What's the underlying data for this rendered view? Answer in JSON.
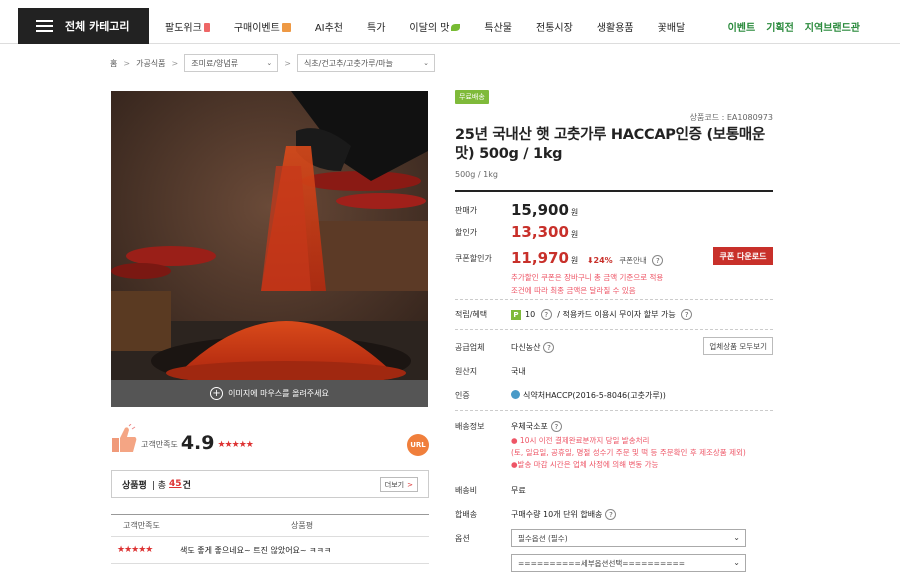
{
  "nav": {
    "all_category": "전체 카테고리",
    "items": [
      "팔도위크",
      "구매이벤트",
      "AI추천",
      "특가",
      "이달의 맛",
      "특산물",
      "전통시장",
      "생활용품",
      "꽃배달"
    ],
    "right_items": [
      "이벤트",
      "기획전",
      "지역브랜드관"
    ]
  },
  "breadcrumb": {
    "home": "홈",
    "level1": "가공식품",
    "level2": "조미료/양념류",
    "level3": "식초/건고추/고춧가루/마늘"
  },
  "image_bar": "이미지에 마우스를 올려주세요",
  "rating": {
    "label": "고객만족도",
    "score": "4.9",
    "stars": "★★★★★",
    "url_label": "URL"
  },
  "review_summary": {
    "label": "상품평",
    "separator": "| 총",
    "count": "45",
    "unit": "건",
    "more": "더보기",
    "more_arrow": ">"
  },
  "review_table": {
    "headers": [
      "고객만족도",
      "상품평"
    ],
    "rows": [
      {
        "stars": "★★★★★",
        "text": "색도 좋게 좋으네요~ 트진 않았어요~ ㅋㅋㅋ"
      }
    ]
  },
  "product": {
    "badge": "무료배송",
    "code": "상품코드 : EA1080973",
    "title": "25년 국내산 햇 고춧가루 HACCAP인증 (보통매운맛) 500g / 1kg",
    "subtitle": "500g / 1kg",
    "sale_label": "판매가",
    "sale_price": "15,900",
    "discount_label": "할인가",
    "discount_price": "13,300",
    "coupon_label": "쿠폰할인가",
    "coupon_price": "11,970",
    "won": "원",
    "coupon_pct": "⬇24%",
    "coupon_info": "쿠폰안내",
    "coupon_button": "쿠폰 다운로드",
    "coupon_note_1": "추가할인 쿠폰은 장바구니 총 금액 기준으로 적용",
    "coupon_note_2": "조건에 따라 최종 금액은 달라질 수 있음",
    "points_label": "적립/혜택",
    "points_badge": "P",
    "points_value": "10",
    "points_extra": "/ 적용카드 이용시 무이자 할부 가능",
    "supplier_label": "공급업체",
    "supplier": "다신농산",
    "supplier_button": "업체상품 모두보기",
    "origin_label": "원산지",
    "origin": "국내",
    "cert_label": "인증",
    "cert": "식약처HACCP(2016-5-8046(고춧가루))",
    "shipping_label": "배송정보",
    "shipping_carrier": "우체국소포",
    "shipping_note_1": "● 10시 이전 결제완료분까지 당일 발송처리",
    "shipping_note_2": "(토, 일요일, 공휴일, 명절 성수기 주문 및 떡 등 주문확인 후 제조상품 제외)",
    "shipping_note_3": "●발송 마감 시간은 업체 사정에 의해 변동 가능",
    "shipfee_label": "배송비",
    "shipfee": "무료",
    "bundle_label": "합배송",
    "bundle": "구매수량 10개 단위 합배송",
    "option_label": "옵션",
    "option_1": "필수옵션 (필수)",
    "option_2": "==========세부옵션선택=========="
  }
}
